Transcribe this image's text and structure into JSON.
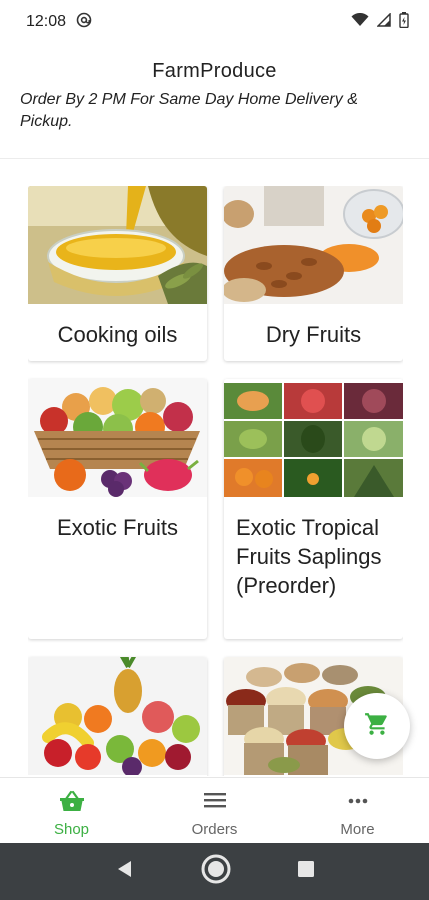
{
  "status_bar": {
    "time": "12:08"
  },
  "header": {
    "title": "FarmProduce",
    "subtitle": "Order By 2 PM For Same Day Home Delivery & Pickup."
  },
  "categories": [
    {
      "label": "Cooking oils",
      "icon": "olive-oil-image"
    },
    {
      "label": "Dry Fruits",
      "icon": "dry-fruits-image"
    },
    {
      "label": "Exotic Fruits",
      "icon": "fruit-basket-image"
    },
    {
      "label": "Exotic Tropical Fruits Saplings (Preorder)",
      "icon": "tropical-fruits-collage-image"
    },
    {
      "label": "",
      "icon": "fruit-pile-image"
    },
    {
      "label": "",
      "icon": "grain-sacks-image"
    }
  ],
  "fab": {
    "icon": "cart-icon"
  },
  "bottom_nav": {
    "items": [
      {
        "label": "Shop",
        "icon": "shop-basket-icon",
        "active": true
      },
      {
        "label": "Orders",
        "icon": "orders-list-icon",
        "active": false
      },
      {
        "label": "More",
        "icon": "more-dots-icon",
        "active": false
      }
    ]
  },
  "colors": {
    "accent": "#3cb043",
    "system_nav": "#3c4043"
  }
}
